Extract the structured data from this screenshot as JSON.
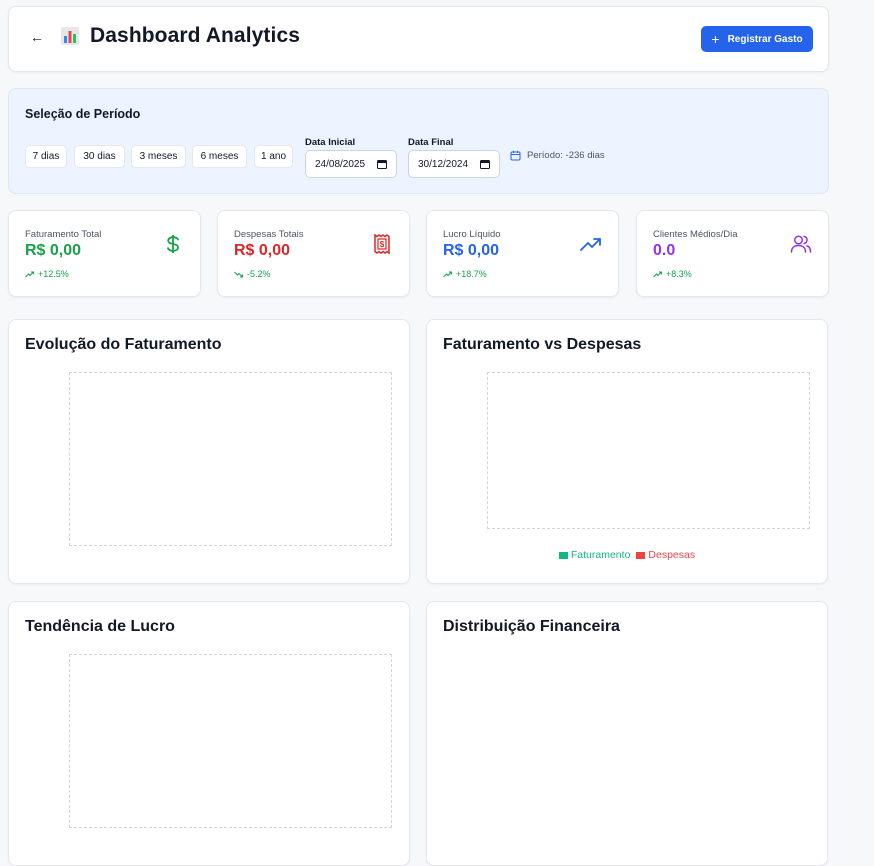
{
  "header": {
    "back_icon": "arrow-left-icon",
    "logo_icon": "bar-chart-emoji-icon",
    "title": "Dashboard Analytics",
    "primary_button": {
      "icon": "plus-icon",
      "label": "Registrar Gasto"
    }
  },
  "period": {
    "title": "Seleção de Período",
    "presets": [
      "7 dias",
      "30 dias",
      "3 meses",
      "6 meses",
      "1 ano"
    ],
    "start_label": "Data Inicial",
    "start_value": "24/08/2025",
    "end_label": "Data Final",
    "end_value": "30/12/2024",
    "info_icon": "calendar-icon",
    "info": "Período: -236 dias"
  },
  "stats": [
    {
      "label": "Faturamento Total",
      "value": "R$ 0,00",
      "change": "+12.5%",
      "trend": "up",
      "icon": "dollar-icon",
      "color": "#16a34a"
    },
    {
      "label": "Despesas Totais",
      "value": "R$ 0,00",
      "change": "-5.2%",
      "trend": "down",
      "icon": "receipt-icon",
      "color": "#dc2626"
    },
    {
      "label": "Lucro Líquido",
      "value": "R$ 0,00",
      "change": "+18.7%",
      "trend": "up",
      "icon": "trending-up-icon",
      "color": "#2563eb"
    },
    {
      "label": "Clientes Médios/Dia",
      "value": "0.0",
      "change": "+8.3%",
      "trend": "up",
      "icon": "users-icon",
      "color": "#9333ea"
    }
  ],
  "charts": {
    "revenue_evolution": {
      "title": "Evolução do Faturamento"
    },
    "revenue_vs_expenses": {
      "title": "Faturamento vs Despesas",
      "legend": [
        {
          "label": "Faturamento",
          "color": "#10b981"
        },
        {
          "label": "Despesas",
          "color": "#ef4444"
        }
      ]
    },
    "profit_trend": {
      "title": "Tendência de Lucro"
    },
    "financial_distribution": {
      "title": "Distribuição Financeira"
    }
  },
  "colors": {
    "accent": "#2563eb",
    "panel_bg": "#eef4ff",
    "page_bg": "#f7f8fa"
  }
}
